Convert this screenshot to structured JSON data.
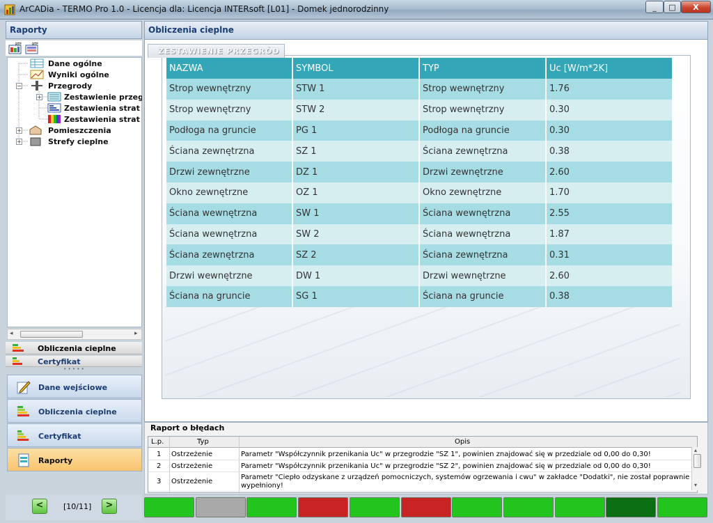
{
  "window": {
    "title": "ArCADia - TERMO Pro 1.0 - Licencja dla: Licencja INTERsoft [L01] - Domek jednorodzinny",
    "buttons": [
      "_",
      "□",
      "X"
    ]
  },
  "left_panel": {
    "header": "Raporty",
    "toolbar_icons": [
      "rtf-export-icon",
      "rtf-export-all-icon"
    ],
    "tree": [
      {
        "label": "Dane ogólne",
        "icon": "table-icon"
      },
      {
        "label": "Wyniki ogólne",
        "icon": "chart-icon"
      },
      {
        "label": "Przegrody",
        "icon": "wall-icon"
      },
      {
        "label": "Zestawienie przegr",
        "icon": "list-icon"
      },
      {
        "label": "Zestawienia strat p",
        "icon": "bars-icon"
      },
      {
        "label": "Zestawienia strat p",
        "icon": "color-map-icon"
      },
      {
        "label": "Pomieszczenia",
        "icon": "room-icon"
      },
      {
        "label": "Strefy cieplne",
        "icon": "zone-icon"
      }
    ],
    "nav_small": [
      "Obliczenia cieplne",
      "Certyfikat"
    ],
    "nav_big": [
      {
        "label": "Dane wejściowe",
        "icon": "pencil-icon"
      },
      {
        "label": "Obliczenia cieplne",
        "icon": "heat-calc-icon"
      },
      {
        "label": "Certyfikat",
        "icon": "energy-label-icon"
      },
      {
        "label": "Raporty",
        "icon": "report-icon"
      }
    ],
    "pager": {
      "prev": "<",
      "text": "[10/11]",
      "next": ">"
    }
  },
  "main": {
    "header": "Obliczenia cieplne",
    "group_title": "ZESTAWIENIE PRZEGRÓD",
    "table": {
      "headers": [
        "NAZWA",
        "SYMBOL",
        "TYP",
        "Uc [W/m*2K]"
      ],
      "rows": [
        [
          "Strop wewnętrzny",
          "STW 1",
          "Strop wewnętrzny",
          "1.76"
        ],
        [
          "Strop wewnętrzny",
          "STW 2",
          "Strop wewnętrzny",
          "0.30"
        ],
        [
          "Podłoga na gruncie",
          "PG 1",
          "Podłoga na gruncie",
          "0.30"
        ],
        [
          "Ściana zewnętrzna",
          "SZ 1",
          "Ściana zewnętrzna",
          "0.38"
        ],
        [
          "Drzwi zewnętrzne",
          "DZ 1",
          "Drzwi zewnętrzne",
          "2.60"
        ],
        [
          "Okno zewnętrzne",
          "OZ 1",
          "Okno zewnętrzne",
          "1.70"
        ],
        [
          "Ściana wewnętrzna",
          "SW 1",
          "Ściana wewnętrzna",
          "2.55"
        ],
        [
          "Ściana wewnętrzna",
          "SW 2",
          "Ściana wewnętrzna",
          "1.87"
        ],
        [
          "Ściana zewnętrzna",
          "SZ 2",
          "Ściana zewnętrzna",
          "0.31"
        ],
        [
          "Drzwi wewnętrzne",
          "DW 1",
          "Drzwi wewnętrzne",
          "2.60"
        ],
        [
          "Ściana na gruncie",
          "SG 1",
          "Ściana na gruncie",
          "0.38"
        ]
      ]
    }
  },
  "errors": {
    "title": "Raport o błędach",
    "headers": [
      "L.p.",
      "Typ",
      "Opis"
    ],
    "rows": [
      {
        "lp": "1",
        "typ": "Ostrzeżenie",
        "opis": "Parametr \"Współczynnik przenikania Uc\" w przegrodzie \"SZ 1\", powinien znajdować się w przedziale od 0,00 do 0,30!",
        "opis2": ""
      },
      {
        "lp": "2",
        "typ": "Ostrzeżenie",
        "opis": "Parametr \"Współczynnik przenikania Uc\" w przegrodzie \"SZ 2\", powinien znajdować się w przedziale od 0,00 do 0,30!",
        "opis2": ""
      },
      {
        "lp": "3",
        "typ": "Ostrzeżenie",
        "opis": "Parametr \"Ciepło odzyskane z urządzeń pomocniczych, systemów ogrzewania i cwu\" w zakładce \"Dodatki\", nie został poprawnie",
        "opis2": "wypełniony!"
      }
    ]
  },
  "status_blocks": [
    "#22c51e",
    "#a9a9a9",
    "#22c51e",
    "#c82424",
    "#22c51e",
    "#c82424",
    "#22c51e",
    "#22c51e",
    "#22c51e",
    "#0b6e12",
    "#22c51e"
  ]
}
